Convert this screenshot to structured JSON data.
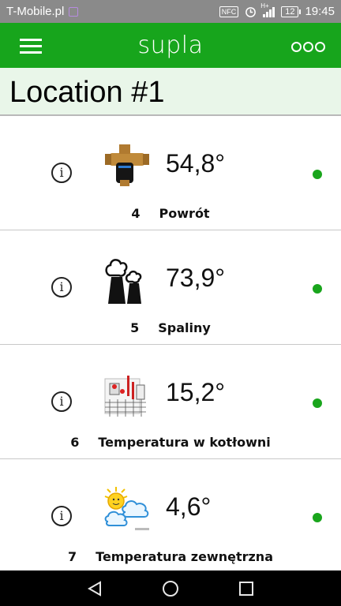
{
  "status_bar": {
    "carrier": "T-Mobile.pl",
    "nfc": "NFC",
    "network": "H+",
    "battery": "12",
    "time": "19:45"
  },
  "app_bar": {
    "title": "supla"
  },
  "location": {
    "title": "Location #1"
  },
  "channels": [
    {
      "number": "4",
      "name": "Powrót",
      "temperature": "54,8°",
      "icon": "valve-icon",
      "online": true
    },
    {
      "number": "5",
      "name": "Spaliny",
      "temperature": "73,9°",
      "icon": "chimney-smoke-icon",
      "online": true
    },
    {
      "number": "6",
      "name": "Temperatura w kotłowni",
      "temperature": "15,2°",
      "icon": "boiler-room-icon",
      "online": true
    },
    {
      "number": "7",
      "name": "Temperatura zewnętrzna",
      "temperature": "4,6°",
      "icon": "sun-cloud-icon",
      "online": true
    }
  ],
  "colors": {
    "brand_green": "#17a51c",
    "online_dot": "#19a51c",
    "location_bg": "#e9f6e9"
  },
  "nav_bar": {
    "back_icon": "back-triangle-icon",
    "home_icon": "home-circle-icon",
    "recents_icon": "recents-square-icon"
  }
}
